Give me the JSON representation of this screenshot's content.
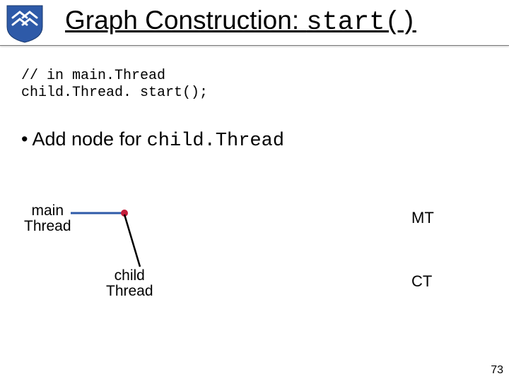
{
  "header": {
    "title_prefix": "Graph Construction: ",
    "title_code": "start()"
  },
  "code": {
    "line1": "// in main.Thread",
    "line2": "child.Thread. start();"
  },
  "bullet": {
    "prefix": "• Add node for ",
    "code": "child.Thread"
  },
  "diagram": {
    "main_label_l1": "main",
    "main_label_l2": "Thread",
    "child_label_l1": "child",
    "child_label_l2": "Thread",
    "mt": "MT",
    "ct": "CT",
    "colors": {
      "line_blue": "#2e5aa8",
      "dot_red": "#c41e3a",
      "diag_line": "#000000"
    }
  },
  "page_number": "73"
}
